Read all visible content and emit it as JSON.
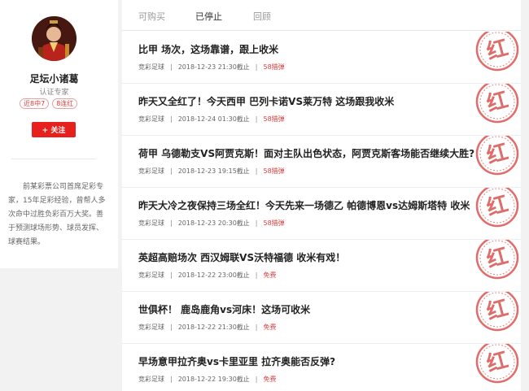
{
  "profile": {
    "name": "足坛小诸葛",
    "title": "认证专家",
    "badges": [
      "近8中7",
      "8连红"
    ],
    "follow_label": "+ 关注",
    "description": "前某彩票公司首席足彩专家，15年足彩经验，曾帮人多次命中过胜负彩百万大奖。善于预测球场形势、球员发挥、球赛结果。"
  },
  "tabs": [
    {
      "label": "可购买",
      "active": false
    },
    {
      "label": "已停止",
      "active": true
    },
    {
      "label": "回顾",
      "active": false
    }
  ],
  "stamp_char": "红",
  "articles": [
    {
      "title": "比甲 场次，这场靠谱，跟上收米",
      "category": "竞彩足球",
      "time": "2018-12-23 21:30截止",
      "price": "58猎弹"
    },
    {
      "title": "昨天又全红了！今天西甲 巴列卡诺VS莱万特 这场跟我收米",
      "category": "竞彩足球",
      "time": "2018-12-24 01:30截止",
      "price": "58猎弹"
    },
    {
      "title": "荷甲 乌德勒支VS阿贾克斯！面对主队出色状态，阿贾克斯客场能否继续大胜?",
      "category": "竞彩足球",
      "time": "2018-12-23 19:15截止",
      "price": "58猎弹"
    },
    {
      "title": "昨天大冷之夜保持三场全红！今天先来一场德乙 帕德博恩vs达姆斯塔特 收米",
      "category": "竞彩足球",
      "time": "2018-12-23 20:30截止",
      "price": "58猎弹"
    },
    {
      "title": "英超高赔场次 西汉姆联VS沃特福德 收米有戏！",
      "category": "竞彩足球",
      "time": "2018-12-22 23:00截止",
      "price": "免费"
    },
    {
      "title": "世俱杯！ 鹿岛鹿角vs河床！这场可收米",
      "category": "竞彩足球",
      "time": "2018-12-22 21:30截止",
      "price": "免费"
    },
    {
      "title": "早场意甲拉齐奥vs卡里亚里 拉齐奥能否反弹?",
      "category": "竞彩足球",
      "time": "2018-12-22 19:30截止",
      "price": "免费"
    }
  ],
  "colors": {
    "accent": "#e8201d",
    "stamp": "#d9534f"
  }
}
